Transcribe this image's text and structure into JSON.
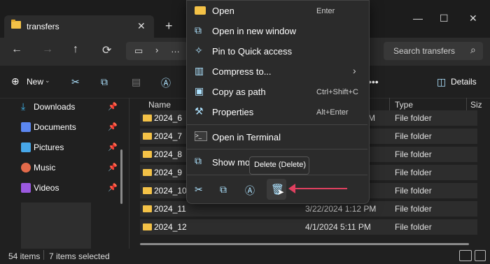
{
  "window": {
    "tab_title": "transfers",
    "tab_close": "✕",
    "tab_add": "+",
    "min": "—",
    "max": "☐",
    "close": "✕"
  },
  "nav": {
    "back": "←",
    "forward": "→",
    "up": "↑",
    "refresh": "⟳",
    "search_placeholder": "Search transfers"
  },
  "toolbar": {
    "new_label": "New",
    "details_label": "Details",
    "more": "•••"
  },
  "sidebar": {
    "items": [
      {
        "label": "Downloads",
        "icon": "download-icon",
        "color": "#3fb7f0"
      },
      {
        "label": "Documents",
        "icon": "document-icon",
        "color": "#5b87f0"
      },
      {
        "label": "Pictures",
        "icon": "pictures-icon",
        "color": "#47a7e8"
      },
      {
        "label": "Music",
        "icon": "music-icon",
        "color": "#e36a4a"
      },
      {
        "label": "Videos",
        "icon": "videos-icon",
        "color": "#9b59e0"
      }
    ]
  },
  "file_list": {
    "headers": {
      "name": "Name",
      "type": "Type",
      "size": "Siz"
    },
    "rows": [
      {
        "name": "2024_6",
        "date": "",
        "date_partial": "M",
        "type": "File folder"
      },
      {
        "name": "2024_7",
        "date": "",
        "type": "File folder"
      },
      {
        "name": "2024_8",
        "date": "",
        "type": "File folder"
      },
      {
        "name": "2024_9",
        "date": "",
        "type": "File folder"
      },
      {
        "name": "2024_10",
        "date": "",
        "type": "File folder"
      },
      {
        "name": "2024_11",
        "date": "3/22/2024 1:12 PM",
        "type": "File folder"
      },
      {
        "name": "2024_12",
        "date": "4/1/2024 5:11 PM",
        "type": "File folder"
      }
    ]
  },
  "context_menu": {
    "items": [
      {
        "label": "Open",
        "shortcut": "Enter",
        "icon": "folder-icon"
      },
      {
        "label": "Open in new window",
        "shortcut": "",
        "icon": "open-new-window-icon"
      },
      {
        "label": "Pin to Quick access",
        "shortcut": "",
        "icon": "pin-icon"
      },
      {
        "label": "Compress to...",
        "shortcut": "›",
        "icon": "compress-icon"
      },
      {
        "label": "Copy as path",
        "shortcut": "Ctrl+Shift+C",
        "icon": "copy-path-icon"
      },
      {
        "label": "Properties",
        "shortcut": "Alt+Enter",
        "icon": "wrench-icon"
      },
      {
        "label": "Open in Terminal",
        "shortcut": "",
        "icon": "terminal-icon"
      },
      {
        "label": "Show mo",
        "shortcut": "",
        "icon": "show-more-icon"
      }
    ],
    "tooltip": "Delete (Delete)"
  },
  "status": {
    "items": "54 items",
    "selected": "7 items selected"
  },
  "colors": {
    "accent": "#aee3ff",
    "arrow": "#e04060",
    "folder": "#f4c247"
  }
}
